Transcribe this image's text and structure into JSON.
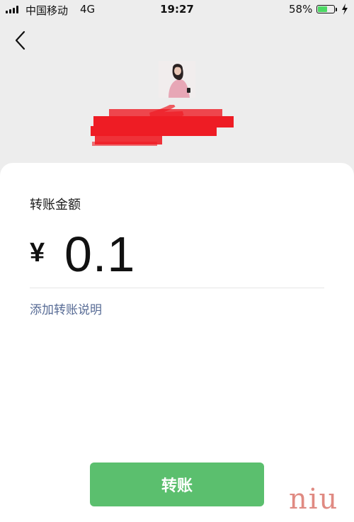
{
  "status_bar": {
    "carrier": "中国移动",
    "network": "4G",
    "time": "19:27",
    "battery_percent": "58%",
    "battery_level": 0.58,
    "signal_icon": "signal-bars-icon",
    "battery_icon": "battery-icon",
    "charging_icon": "charging-bolt-icon"
  },
  "nav": {
    "back_icon": "chevron-left-icon"
  },
  "transfer": {
    "amount_label": "转账金额",
    "currency_symbol": "¥",
    "amount": "0.1",
    "add_note_link": "添加转账说明",
    "submit_button": "转账"
  },
  "watermark": {
    "text": "niu"
  },
  "colors": {
    "page_background": "#ededed",
    "card_background": "#ffffff",
    "button_green": "#5bbf6e",
    "link_blue": "#576b95",
    "redaction_red": "#ee1c24",
    "watermark": "#e08a82"
  }
}
